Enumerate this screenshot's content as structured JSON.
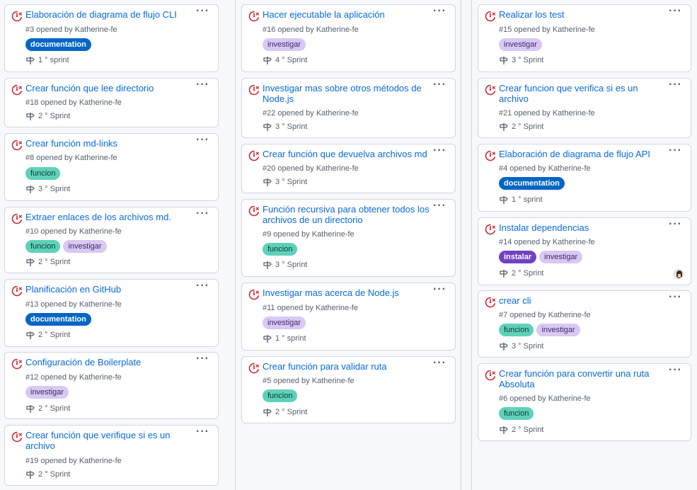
{
  "colors": {
    "link": "#0969da",
    "issue_icon": "#cf222e",
    "documentation": "#0366c6",
    "funcion": "#5fd1b9",
    "investigar": "#d8c8f3",
    "instalar": "#6f42c1"
  },
  "columns": [
    {
      "cards": [
        {
          "title": "Elaboración de diagrama de flujo CLI",
          "meta": "#3 opened by Katherine-fe",
          "labels": [
            "documentation"
          ],
          "milestone": "1 ° sprint"
        },
        {
          "title": "Crear función que lee directorio",
          "meta": "#18 opened by Katherine-fe",
          "labels": [],
          "milestone": "2 ° Sprint"
        },
        {
          "title": "Crear función md-links",
          "meta": "#8 opened by Katherine-fe",
          "labels": [
            "funcion"
          ],
          "milestone": "3 ° Sprint"
        },
        {
          "title": "Extraer enlaces de los archivos md.",
          "meta": "#10 opened by Katherine-fe",
          "labels": [
            "funcion",
            "investigar"
          ],
          "milestone": "2 ° Sprint"
        },
        {
          "title": "Planificación en GitHub",
          "meta": "#13 opened by Katherine-fe",
          "labels": [
            "documentation"
          ],
          "milestone": "2 ° Sprint"
        },
        {
          "title": "Configuración de Boilerplate",
          "meta": "#12 opened by Katherine-fe",
          "labels": [
            "investigar"
          ],
          "milestone": "2 ° Sprint"
        },
        {
          "title": "Crear función que verifique si es un archivo",
          "meta": "#19 opened by Katherine-fe",
          "labels": [],
          "milestone": "2 ° Sprint"
        }
      ]
    },
    {
      "cards": [
        {
          "title": "Hacer ejecutable la aplicación",
          "meta": "#16 opened by Katherine-fe",
          "labels": [
            "investigar"
          ],
          "milestone": "4 ° Sprint"
        },
        {
          "title": "Investigar mas sobre otros métodos de Node.js",
          "meta": "#22 opened by Katherine-fe",
          "labels": [],
          "milestone": "3 ° Sprint"
        },
        {
          "title": "Crear función que devuelva archivos md",
          "meta": "#20 opened by Katherine-fe",
          "labels": [],
          "milestone": "3 ° Sprint"
        },
        {
          "title": "Función recursiva para obtener todos los archivos de un directorio",
          "meta": "#9 opened by Katherine-fe",
          "labels": [
            "funcion"
          ],
          "milestone": "3 ° Sprint"
        },
        {
          "title": "Investigar mas acerca de Node.js",
          "meta": "#11 opened by Katherine-fe",
          "labels": [
            "investigar"
          ],
          "milestone": "1 ° sprint"
        },
        {
          "title": "Crear función para validar ruta",
          "meta": "#5 opened by Katherine-fe",
          "labels": [
            "funcion"
          ],
          "milestone": "2 ° Sprint"
        }
      ]
    },
    {
      "cards": [
        {
          "title": "Realizar los test",
          "meta": "#15 opened by Katherine-fe",
          "labels": [
            "investigar"
          ],
          "milestone": "3 ° Sprint"
        },
        {
          "title": "Crear funcion que verifica si es un archivo",
          "meta": "#21 opened by Katherine-fe",
          "labels": [],
          "milestone": "2 ° Sprint"
        },
        {
          "title": "Elaboración de diagrama de flujo API",
          "meta": "#4 opened by Katherine-fe",
          "labels": [
            "documentation"
          ],
          "milestone": "1 ° sprint"
        },
        {
          "title": "Instalar dependencias",
          "meta": "#14 opened by Katherine-fe",
          "labels": [
            "instalar",
            "investigar"
          ],
          "milestone": "2 ° Sprint",
          "assignee": true
        },
        {
          "title": "crear cli",
          "meta": "#7 opened by Katherine-fe",
          "labels": [
            "funcion",
            "investigar"
          ],
          "milestone": "3 ° Sprint"
        },
        {
          "title": "Crear función para convertir una ruta Absoluta",
          "meta": "#6 opened by Katherine-fe",
          "labels": [
            "funcion"
          ],
          "milestone": "2 ° Sprint"
        }
      ]
    }
  ]
}
